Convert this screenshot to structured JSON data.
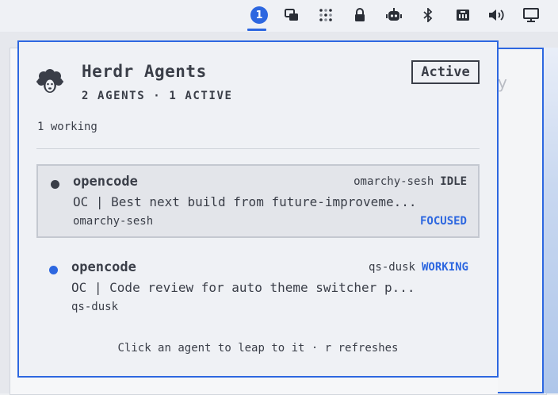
{
  "tray": {
    "badge_count": "1",
    "icons": [
      "agents-badge-icon",
      "window-switch-icon",
      "grid-dots-icon",
      "lock-icon",
      "robot-icon",
      "bluetooth-icon",
      "network-icon",
      "volume-icon",
      "display-icon"
    ]
  },
  "background": {
    "partial_text": "y"
  },
  "popup": {
    "title": "Herdr Agents",
    "subtitle": "2 AGENTS · 1 ACTIVE",
    "status": "Active",
    "working_count": "1 working",
    "footer": "Click an agent to leap to it · r refreshes",
    "agents": [
      {
        "name": "opencode",
        "session_right": "omarchy-sesh",
        "state": "IDLE",
        "state_color": "#3a3e48",
        "dot_color": "#3a3e48",
        "description": "OC | Best next build from future-improveme...",
        "session": "omarchy-sesh",
        "focus_label": "FOCUSED"
      },
      {
        "name": "opencode",
        "session_right": "qs-dusk",
        "state": "WORKING",
        "state_color": "#2d67e0",
        "dot_color": "#2d67e0",
        "description": "OC | Code review for auto theme switcher p...",
        "session": "qs-dusk",
        "focus_label": ""
      }
    ]
  },
  "colors": {
    "accent": "#2d67e0",
    "text": "#3a3e48",
    "background": "#eff1f5"
  }
}
